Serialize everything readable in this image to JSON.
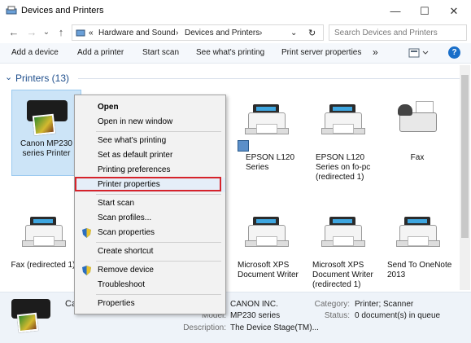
{
  "window": {
    "title": "Devices and Printers",
    "controls": [
      "—",
      "☐",
      "✕"
    ]
  },
  "nav": {
    "back": "←",
    "forward": "→",
    "dropdown": "⌄",
    "up": "↑",
    "chev": "«",
    "breadcrumb": [
      "Hardware and Sound",
      "Devices and Printers"
    ],
    "sep": "›",
    "refresh": "↻",
    "search_placeholder": "Search Devices and Printers"
  },
  "commands": {
    "items": [
      "Add a device",
      "Add a printer",
      "Start scan",
      "See what's printing",
      "Print server properties"
    ],
    "overflow": "»",
    "help": "?"
  },
  "group": {
    "label": "Printers (13)",
    "toggle": "⌄"
  },
  "devices": [
    {
      "label": "Canon MP230 series Printer",
      "icon": "canon-printer"
    },
    {
      "label": "EPSON L120 Series",
      "icon": "printer"
    },
    {
      "label": "EPSON L120 Series on fo-pc (redirected 1)",
      "icon": "printer"
    },
    {
      "label": "Fax",
      "icon": "fax"
    },
    {
      "label": "Fax (redirected 1)",
      "icon": "printer"
    },
    {
      "label": "Microsoft XPS Document Writer",
      "icon": "printer"
    },
    {
      "label": "Microsoft XPS Document Writer (redirected 1)",
      "icon": "printer"
    },
    {
      "label": "Send To OneNote 2013",
      "icon": "printer"
    }
  ],
  "context_menu": {
    "items": [
      {
        "label": "Open",
        "bold": true
      },
      {
        "label": "Open in new window"
      },
      {
        "label": "See what's printing"
      },
      {
        "label": "Set as default printer"
      },
      {
        "label": "Printing preferences"
      },
      {
        "label": "Printer properties",
        "highlighted": true
      },
      {
        "label": "Start scan"
      },
      {
        "label": "Scan profiles..."
      },
      {
        "label": "Scan properties",
        "shield": true
      },
      {
        "label": "Create shortcut"
      },
      {
        "label": "Remove device",
        "shield": true
      },
      {
        "label": "Troubleshoot"
      },
      {
        "label": "Properties"
      }
    ]
  },
  "details": {
    "name_partial": "Ca",
    "manufacturer": "CANON INC.",
    "model_label": "Model:",
    "model": "MP230 series",
    "description_label": "Description:",
    "description": "The Device Stage(TM)...",
    "category_label": "Category:",
    "category": "Printer; Scanner",
    "status_label": "Status:",
    "status": "0 document(s) in queue"
  },
  "colors": {
    "highlight_border": "#d6232a",
    "selection": "#cce4f7",
    "group_header": "#1e4e8c"
  }
}
